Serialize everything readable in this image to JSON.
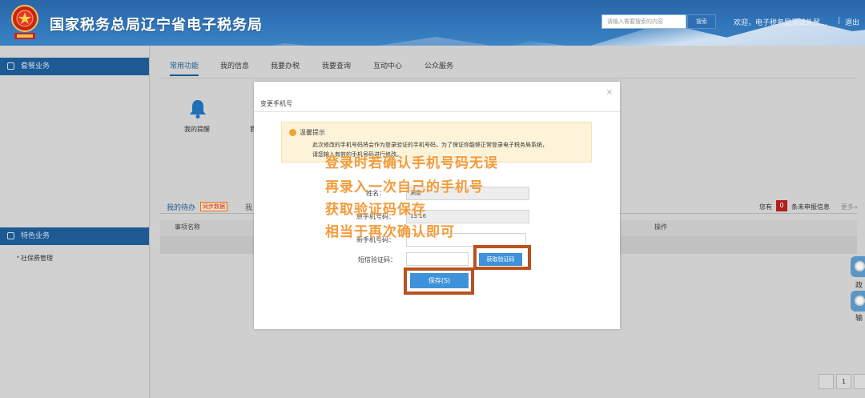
{
  "header": {
    "site_title": "国家税务总局辽宁省电子税务局",
    "search_placeholder": "请输入需要搜索的内容",
    "search_button": "搜索",
    "welcome": "欢迎，电子税务局测试外贸...",
    "separator": "|",
    "logout": "退出"
  },
  "sidebar": {
    "section1_title": "套餐业务",
    "section2_title": "特色业务",
    "section2_items": [
      "社保费管理"
    ]
  },
  "main": {
    "tabs": [
      {
        "label": "常用功能",
        "active": true
      },
      {
        "label": "我的信息",
        "active": false
      },
      {
        "label": "我要办税",
        "active": false
      },
      {
        "label": "我要查询",
        "active": false
      },
      {
        "label": "互动中心",
        "active": false
      },
      {
        "label": "公众服务",
        "active": false
      }
    ],
    "quick_item_label": "我的提醒",
    "quick_item2_fragment": "我",
    "todo_tab": "我的待办",
    "todo_badge": "同步数据",
    "todo_tab2_fragment": "我",
    "col_item_name": "事项名称",
    "col_operation": "操作",
    "you_have": "您有",
    "unreported_count": "0",
    "unreported_text": "条未申报信息",
    "more": "更多»",
    "pager": [
      "",
      "1",
      ""
    ],
    "float_buttons": [
      "政",
      "输"
    ]
  },
  "modal": {
    "title": "变更手机号",
    "close": "×",
    "notice_title": "温馨提示",
    "notice_line1": "此次修改的手机号码将会作为登录验证的手机号码，为了保证你能够正常登录电子税务局系统，",
    "notice_line2": "请您输入有效的手机号码进行修改。",
    "fields": {
      "name_label": "姓名：",
      "name_value": "满雷",
      "old_phone_label": "原手机号码：",
      "old_phone_value": "13          16",
      "new_phone_label": "新手机号码：",
      "new_phone_value": "",
      "sms_code_label": "短信验证码：",
      "sms_code_value": ""
    },
    "get_code_button": "获取验证码",
    "save_button": "保存(S)"
  },
  "annotation": {
    "lines": [
      "登录时若确认手机号码无误",
      "再录入一次自己的手机号",
      "获取验证码保存",
      "相当于再次确认即可"
    ]
  },
  "colors": {
    "header_blue": "#2f73b8",
    "sidebar_head": "#1d5a94",
    "button_blue": "#3f92da",
    "highlight_border": "#b9521e",
    "annotation_orange": "#f29b3b",
    "badge_red": "#b01e1e"
  }
}
